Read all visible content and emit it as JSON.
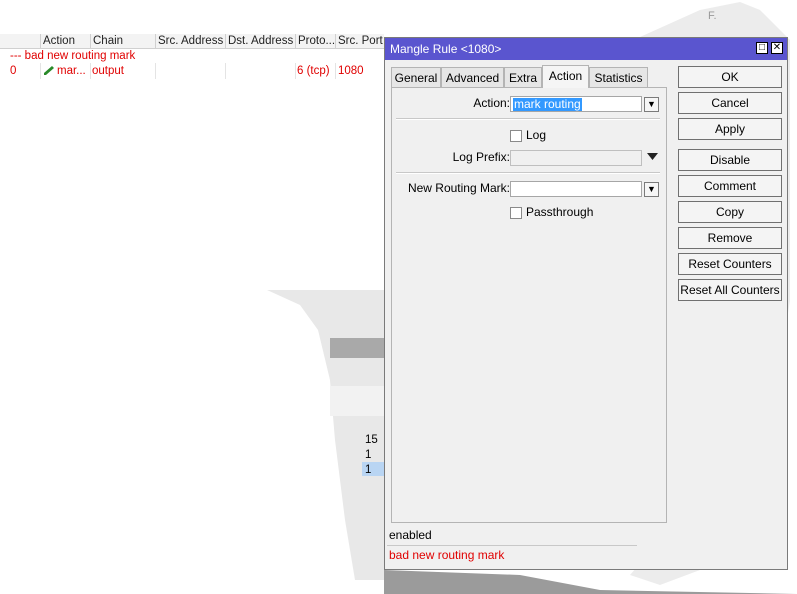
{
  "table": {
    "columns": [
      "Action",
      "Chain",
      "Src. Address",
      "Dst. Address",
      "Proto...",
      "Src. Port"
    ],
    "comment": "--- bad new routing mark",
    "row": {
      "index": "0",
      "action": "mar...",
      "chain": "output",
      "protocol": "6 (tcp)",
      "src_port": "1080"
    }
  },
  "fragments": {
    "f1": "15",
    "f2": "1",
    "f3": "1",
    "corner": "F."
  },
  "dialog": {
    "title": "Mangle Rule <1080>",
    "restore_symbol": "□",
    "close_symbol": "✕",
    "tabs": [
      "General",
      "Advanced",
      "Extra",
      "Action",
      "Statistics"
    ],
    "active_tab": "Action",
    "form": {
      "action_label": "Action:",
      "action_value": "mark routing",
      "log_label": "Log",
      "log_prefix_label": "Log Prefix:",
      "log_prefix_value": "",
      "new_routing_mark_label": "New Routing Mark:",
      "new_routing_mark_value": "",
      "passthrough_label": "Passthrough"
    },
    "buttons": [
      "OK",
      "Cancel",
      "Apply",
      "Disable",
      "Comment",
      "Copy",
      "Remove",
      "Reset Counters",
      "Reset All Counters"
    ],
    "status": "enabled",
    "comment": "bad new routing mark"
  },
  "colors": {
    "titlebar": "#5a55cf",
    "comment_red": "#e00000",
    "selection": "#3399ff"
  }
}
